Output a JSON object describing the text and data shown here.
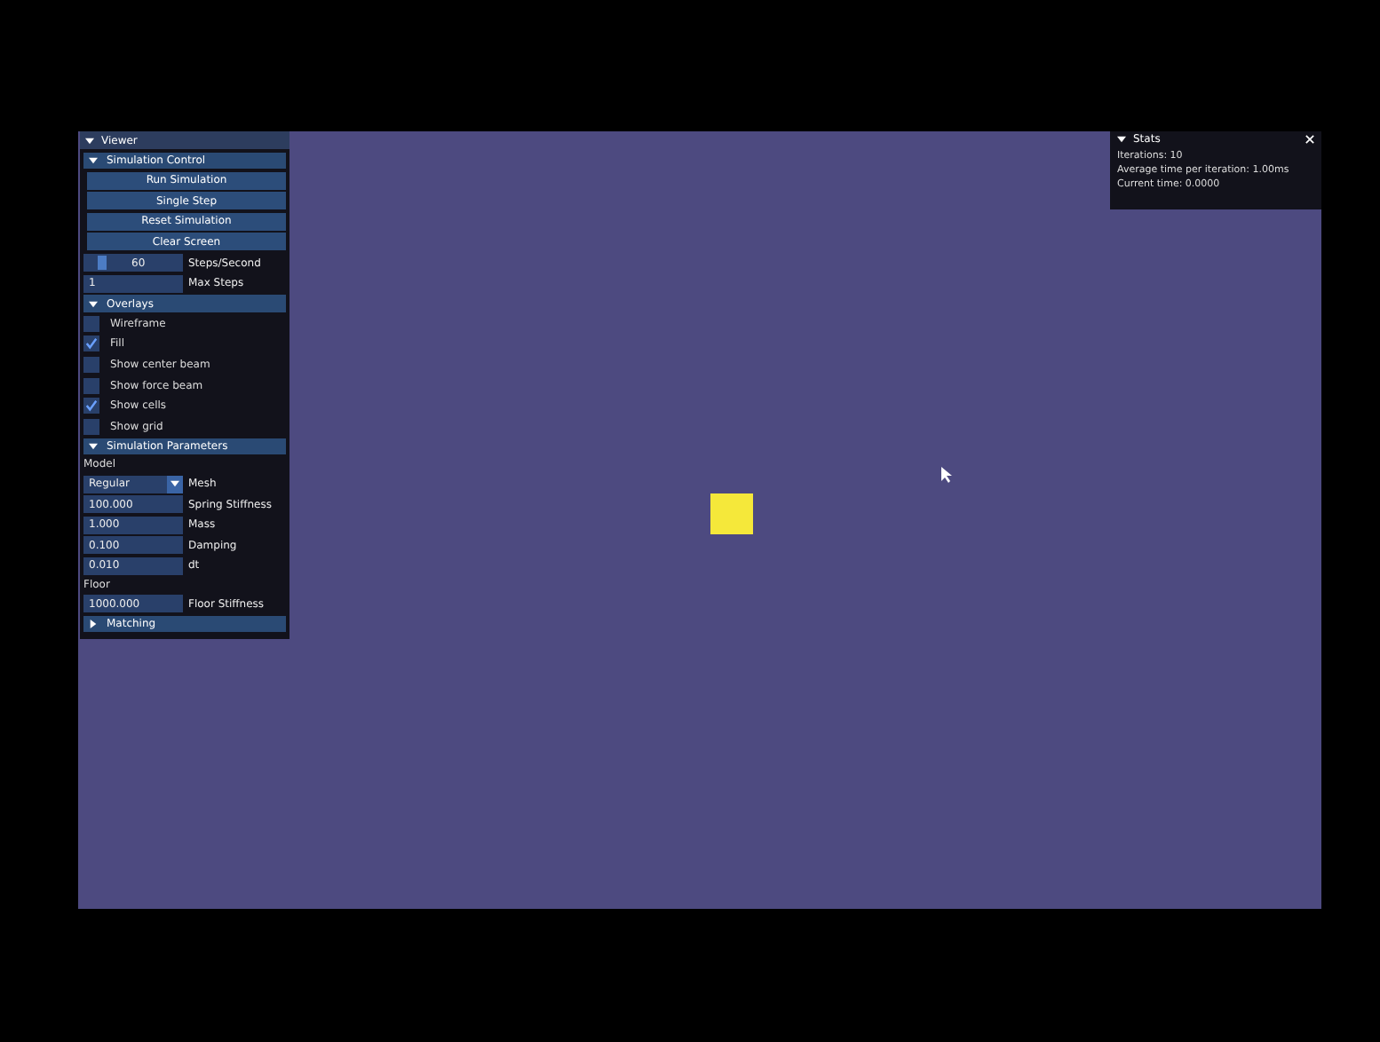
{
  "viewer": {
    "title": "Viewer",
    "sections": [
      {
        "kind": "control",
        "title": "Simulation Control",
        "expanded": true,
        "buttons": [
          "Run Simulation",
          "Single Step",
          "Reset Simulation",
          "Clear Screen"
        ],
        "steps_slider": {
          "value": "60",
          "label": "Steps/Second",
          "level": 0.15
        },
        "max_steps": {
          "value": "1",
          "label": "Max Steps"
        }
      },
      {
        "kind": "overlays",
        "title": "Overlays",
        "expanded": true,
        "checks": [
          {
            "label": "Wireframe",
            "checked": false
          },
          {
            "label": "Fill",
            "checked": true
          },
          {
            "label": "Show center beam",
            "checked": false
          },
          {
            "label": "Show force beam",
            "checked": false
          },
          {
            "label": "Show cells",
            "checked": true
          },
          {
            "label": "Show grid",
            "checked": false
          }
        ]
      },
      {
        "kind": "params",
        "title": "Simulation Parameters",
        "expanded": true,
        "model_label": "Model",
        "model": {
          "value": "Regular",
          "label": "Mesh"
        },
        "fields": [
          {
            "value": "100.000",
            "label": "Spring Stiffness"
          },
          {
            "value": "1.000",
            "label": "Mass"
          },
          {
            "value": "0.100",
            "label": "Damping"
          },
          {
            "value": "0.010",
            "label": "dt"
          }
        ],
        "floor_label": "Floor",
        "floor_field": {
          "value": "1000.000",
          "label": "Floor Stiffness"
        }
      },
      {
        "kind": "collapsed",
        "title": "Matching",
        "expanded": false
      }
    ]
  },
  "stats": {
    "title": "Stats",
    "lines": [
      "Iterations: 10",
      "Average time per iteration: 1.00ms",
      "Current time: 0.0000"
    ]
  }
}
